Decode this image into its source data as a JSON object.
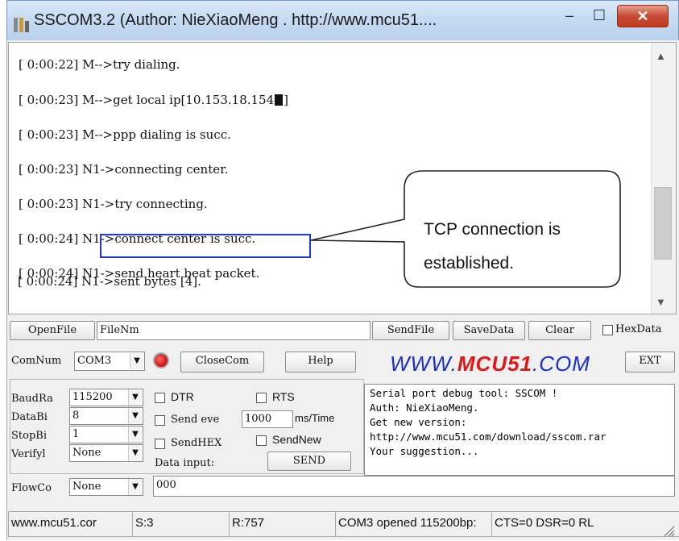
{
  "window": {
    "title": "SSCOM3.2 (Author: NieXiaoMeng . http://www.mcu51....",
    "min_symbol": "–",
    "max_symbol": "☐",
    "close_symbol": "✕"
  },
  "log": [
    "[ 0:00:22] M-->try dialing.",
    "[ 0:00:23] M-->get local ip[10.153.18.154",
    "[ 0:00:23] M-->ppp dialing is succ.",
    "[ 0:00:23] N1->connecting center.",
    "[ 0:00:23] N1->try connecting.",
    "[ 0:00:24] N1->connect center is succ.",
    "[ 0:00:24] N1->send heart beat packet.",
    "[ 0:00:24] N1->sent bytes [4]."
  ],
  "log_suffix": "]",
  "callout": {
    "line1": "TCP  connection  is",
    "line2": "established."
  },
  "row1": {
    "openfile": "OpenFile",
    "filename": "FileNm",
    "sendfile": "SendFile",
    "savedata": "SaveData",
    "clear": "Clear",
    "hexdata": "HexData"
  },
  "row2": {
    "comnum_label": "ComNum",
    "comnum_value": "COM3",
    "closecom": "CloseCom",
    "help": "Help",
    "logo_a": "WWW.",
    "logo_b": "MCU51",
    "logo_c": ".COM",
    "ext": "EXT"
  },
  "settings": {
    "baud_label": "BaudRa",
    "baud_value": "115200",
    "databits_label": "DataBi",
    "databits_value": "8",
    "stopbits_label": "StopBi",
    "stopbits_value": "1",
    "verify_label": "Verifyl",
    "verify_value": "None",
    "flow_label": "FlowCo",
    "flow_value": "None",
    "dtr": "DTR",
    "rts": "RTS",
    "send_every": "Send eve",
    "interval": "1000",
    "ms_unit": "ms/Time",
    "sendhex": "SendHEX",
    "sendnew": "SendNew",
    "data_input_label": "Data input:",
    "send_button": "SEND",
    "input_value": "000"
  },
  "info": [
    "Serial port debug tool: SSCOM !",
    "Auth: NieXiaoMeng.",
    "Get new version:",
    "http://www.mcu51.com/download/sscom.rar",
    "Your suggestion..."
  ],
  "status": {
    "site": "www.mcu51.cor",
    "sent": "S:3",
    "received": "R:757",
    "port": "COM3 opened 115200bp:",
    "lines": "CTS=0 DSR=0 RL"
  },
  "colors": {
    "logo_blue": "#1a2fc8",
    "logo_red": "#e01818",
    "highlight": "#1f3ad8",
    "led": "#d42020"
  }
}
